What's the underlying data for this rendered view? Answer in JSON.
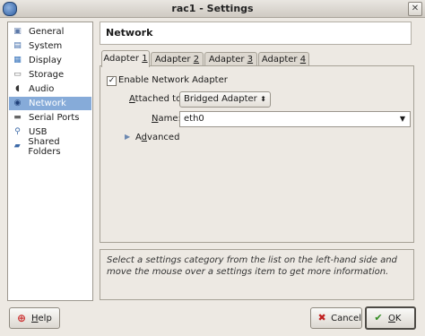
{
  "window": {
    "title": "rac1 - Settings"
  },
  "sidebar": {
    "items": [
      {
        "label": "General",
        "icon": "general-icon"
      },
      {
        "label": "System",
        "icon": "system-icon"
      },
      {
        "label": "Display",
        "icon": "display-icon"
      },
      {
        "label": "Storage",
        "icon": "storage-icon"
      },
      {
        "label": "Audio",
        "icon": "audio-icon"
      },
      {
        "label": "Network",
        "icon": "network-icon",
        "selected": true
      },
      {
        "label": "Serial Ports",
        "icon": "serial-ports-icon"
      },
      {
        "label": "USB",
        "icon": "usb-icon"
      },
      {
        "label": "Shared Folders",
        "icon": "shared-folders-icon"
      }
    ]
  },
  "panel": {
    "title": "Network"
  },
  "tabs": [
    {
      "label": "Adapter ",
      "mnemonic": "1"
    },
    {
      "label": "Adapter ",
      "mnemonic": "2"
    },
    {
      "label": "Adapter ",
      "mnemonic": "3"
    },
    {
      "label": "Adapter ",
      "mnemonic": "4"
    }
  ],
  "adapter": {
    "enable_label": "Enable Network Adapter",
    "enable_checked": true,
    "attached_label_mnemonic": "A",
    "attached_label_rest": "ttached to:",
    "attached_value": "Bridged Adapter",
    "name_label_mnemonic": "N",
    "name_label_rest": "ame:",
    "name_value": "eth0",
    "advanced_label_mnemonic": "d",
    "advanced_label_pre": "A",
    "advanced_label_rest": "vanced"
  },
  "info": {
    "text": "Select a settings category from the list on the left-hand side and move the mouse over a settings item to get more information."
  },
  "buttons": {
    "help_mnemonic": "H",
    "help_rest": "elp",
    "cancel_label": "Cancel",
    "ok_mnemonic": "O",
    "ok_rest": "K"
  },
  "colors": {
    "selection": "#86abd9",
    "window_bg": "#ede9e3"
  }
}
